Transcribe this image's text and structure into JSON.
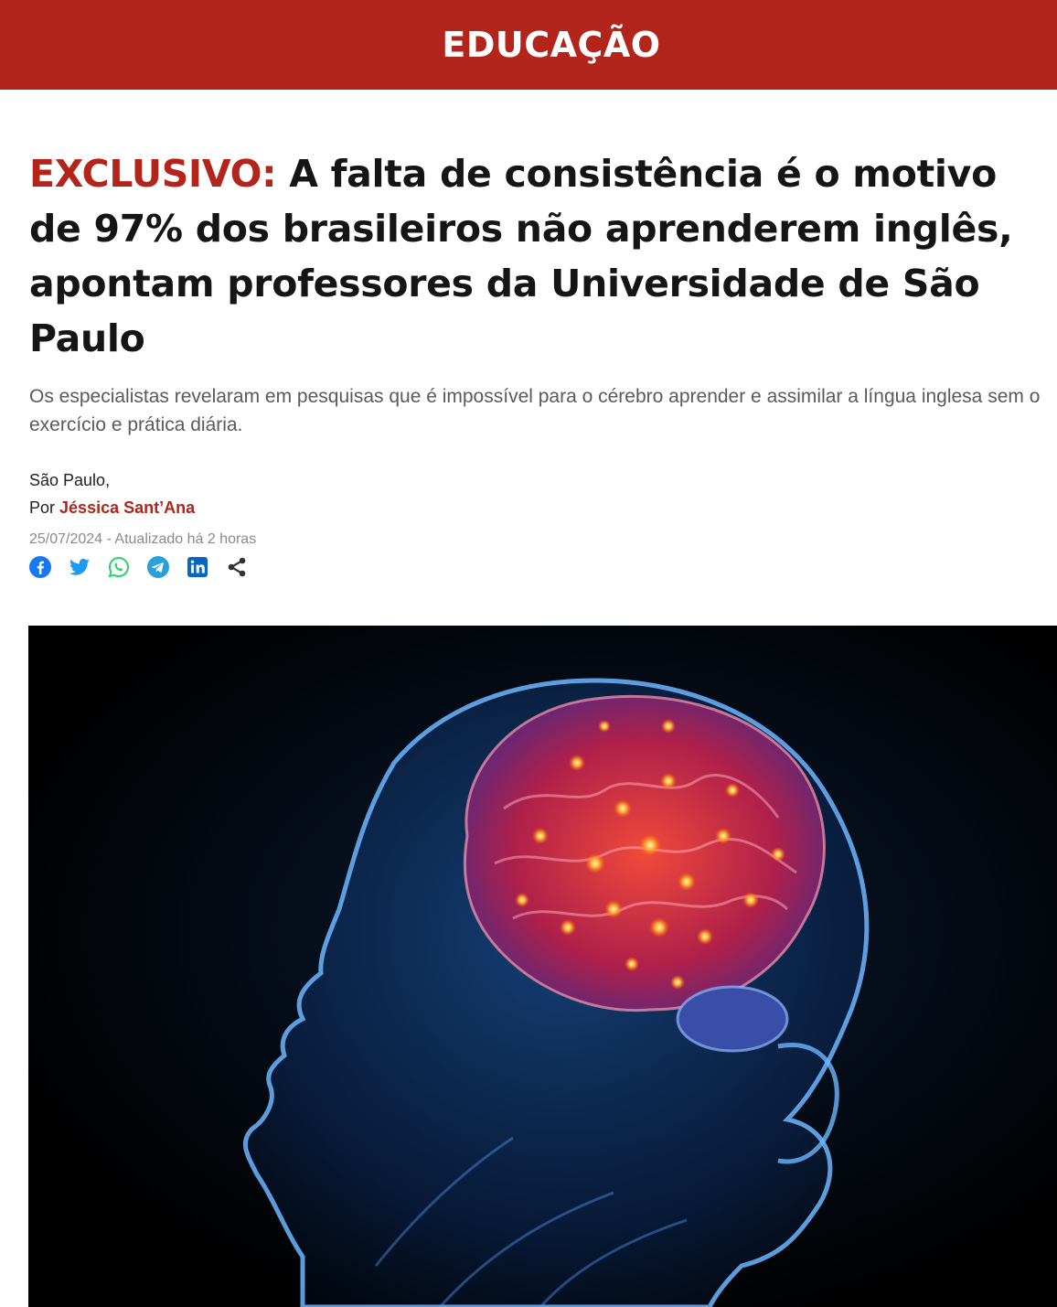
{
  "header": {
    "section": "EDUCAÇÃO",
    "bg_color": "#b3241b"
  },
  "article": {
    "kicker": "EXCLUSIVO:",
    "title": "A falta de consistência é o motivo de 97% dos brasileiros não aprenderem inglês, apontam professores da Universidade de São Paulo",
    "subtitle": "Os especialistas revelaram em pesquisas que é impossível para o cérebro aprender e assimilar a língua inglesa sem o exercício e prática diária.",
    "location": "São Paulo,",
    "by_label": "Por",
    "author": "Jéssica Sant’Ana",
    "date": "25/07/2024 - Atualizado há 2 horas",
    "accent_color": "#b3241b"
  },
  "share": {
    "icons": [
      "facebook-icon",
      "twitter-icon",
      "whatsapp-icon",
      "telegram-icon",
      "linkedin-icon",
      "share-icon"
    ]
  },
  "hero_image": {
    "subject": "glowing-brain-head-illustration"
  }
}
